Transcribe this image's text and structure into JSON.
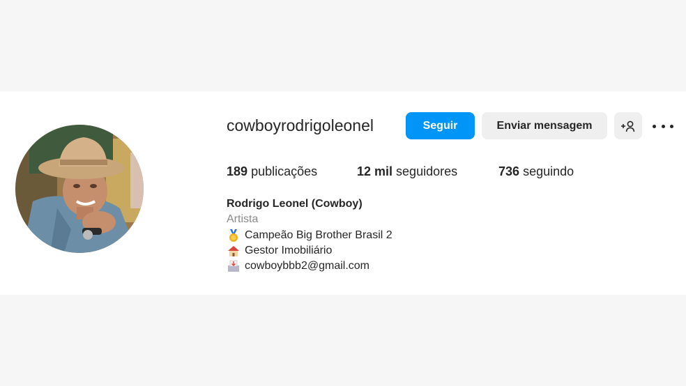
{
  "profile": {
    "username": "cowboyrodrigoleonel",
    "avatar_icon": "profile-photo-cowboy-hat"
  },
  "actions": {
    "follow_label": "Seguir",
    "message_label": "Enviar mensagem",
    "add_friend_icon": "add-person-icon",
    "more_icon": "more-options-icon"
  },
  "stats": {
    "posts_count": "189",
    "posts_label": "publicações",
    "followers_count": "12 mil",
    "followers_label": "seguidores",
    "following_count": "736",
    "following_label": "seguindo"
  },
  "bio": {
    "name": "Rodrigo Leonel (Cowboy)",
    "category": "Artista",
    "lines": [
      {
        "icon": "medal-emoji",
        "text": "Campeão Big Brother Brasil 2"
      },
      {
        "icon": "house-emoji",
        "text": "Gestor Imobiliário"
      },
      {
        "icon": "inbox-tray-emoji",
        "text": "cowboybbb2@gmail.com"
      }
    ]
  },
  "colors": {
    "accent": "#0095f6",
    "secondary_button": "#efefef",
    "background": "#f6f6f6",
    "text": "#262626",
    "muted_text": "#8a8a8a"
  }
}
